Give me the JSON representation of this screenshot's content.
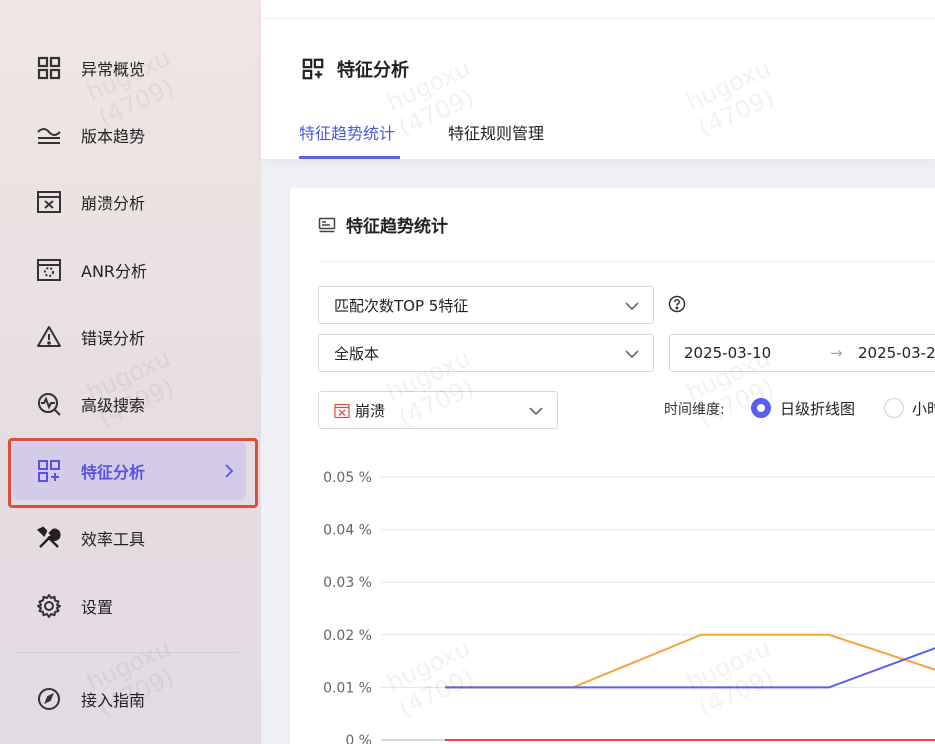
{
  "sidebar": {
    "items": [
      {
        "label": "异常概览",
        "icon": "dashboard-grid-icon"
      },
      {
        "label": "版本趋势",
        "icon": "waves-icon"
      },
      {
        "label": "崩溃分析",
        "icon": "window-close-icon"
      },
      {
        "label": "ANR分析",
        "icon": "window-loading-icon"
      },
      {
        "label": "错误分析",
        "icon": "warning-triangle-icon"
      },
      {
        "label": "高级搜索",
        "icon": "magnify-pulse-icon"
      },
      {
        "label": "特征分析",
        "icon": "grid-plus-icon",
        "active": true
      },
      {
        "label": "效率工具",
        "icon": "tools-icon"
      },
      {
        "label": "设置",
        "icon": "gear-icon"
      },
      {
        "label": "接入指南",
        "icon": "compass-icon"
      }
    ]
  },
  "header": {
    "title": "特征分析",
    "tabs": [
      {
        "label": "特征趋势统计",
        "active": true
      },
      {
        "label": "特征规则管理"
      }
    ]
  },
  "card": {
    "title": "特征趋势统计",
    "feature_select": "匹配次数TOP 5特征",
    "version_select": "全版本",
    "date_start": "2025-03-10",
    "date_end": "2025-03-2",
    "date_sep": "→",
    "type_select": "崩溃",
    "time_dimension_label": "时间维度:",
    "radio_daily": "日级折线图",
    "radio_hourly": "小时"
  },
  "chart_data": {
    "type": "line",
    "y_tick_labels": [
      "0 %",
      "0.01 %",
      "0.02 %",
      "0.03 %",
      "0.04 %",
      "0.05 %"
    ],
    "ylim": [
      0,
      0.05
    ],
    "series": [
      {
        "color": "#f5a43a",
        "values": [
          0.01,
          0.01,
          0.02,
          0.02,
          0.012
        ]
      },
      {
        "color": "#5b5ff0",
        "values": [
          0.01,
          0.01,
          0.01,
          0.01,
          0.019
        ]
      },
      {
        "color": "#e24a4a",
        "values": [
          0,
          0,
          0,
          0,
          0
        ]
      }
    ],
    "grid": true
  },
  "watermark": {
    "text": "hugoxu",
    "sub": "(4709)"
  }
}
